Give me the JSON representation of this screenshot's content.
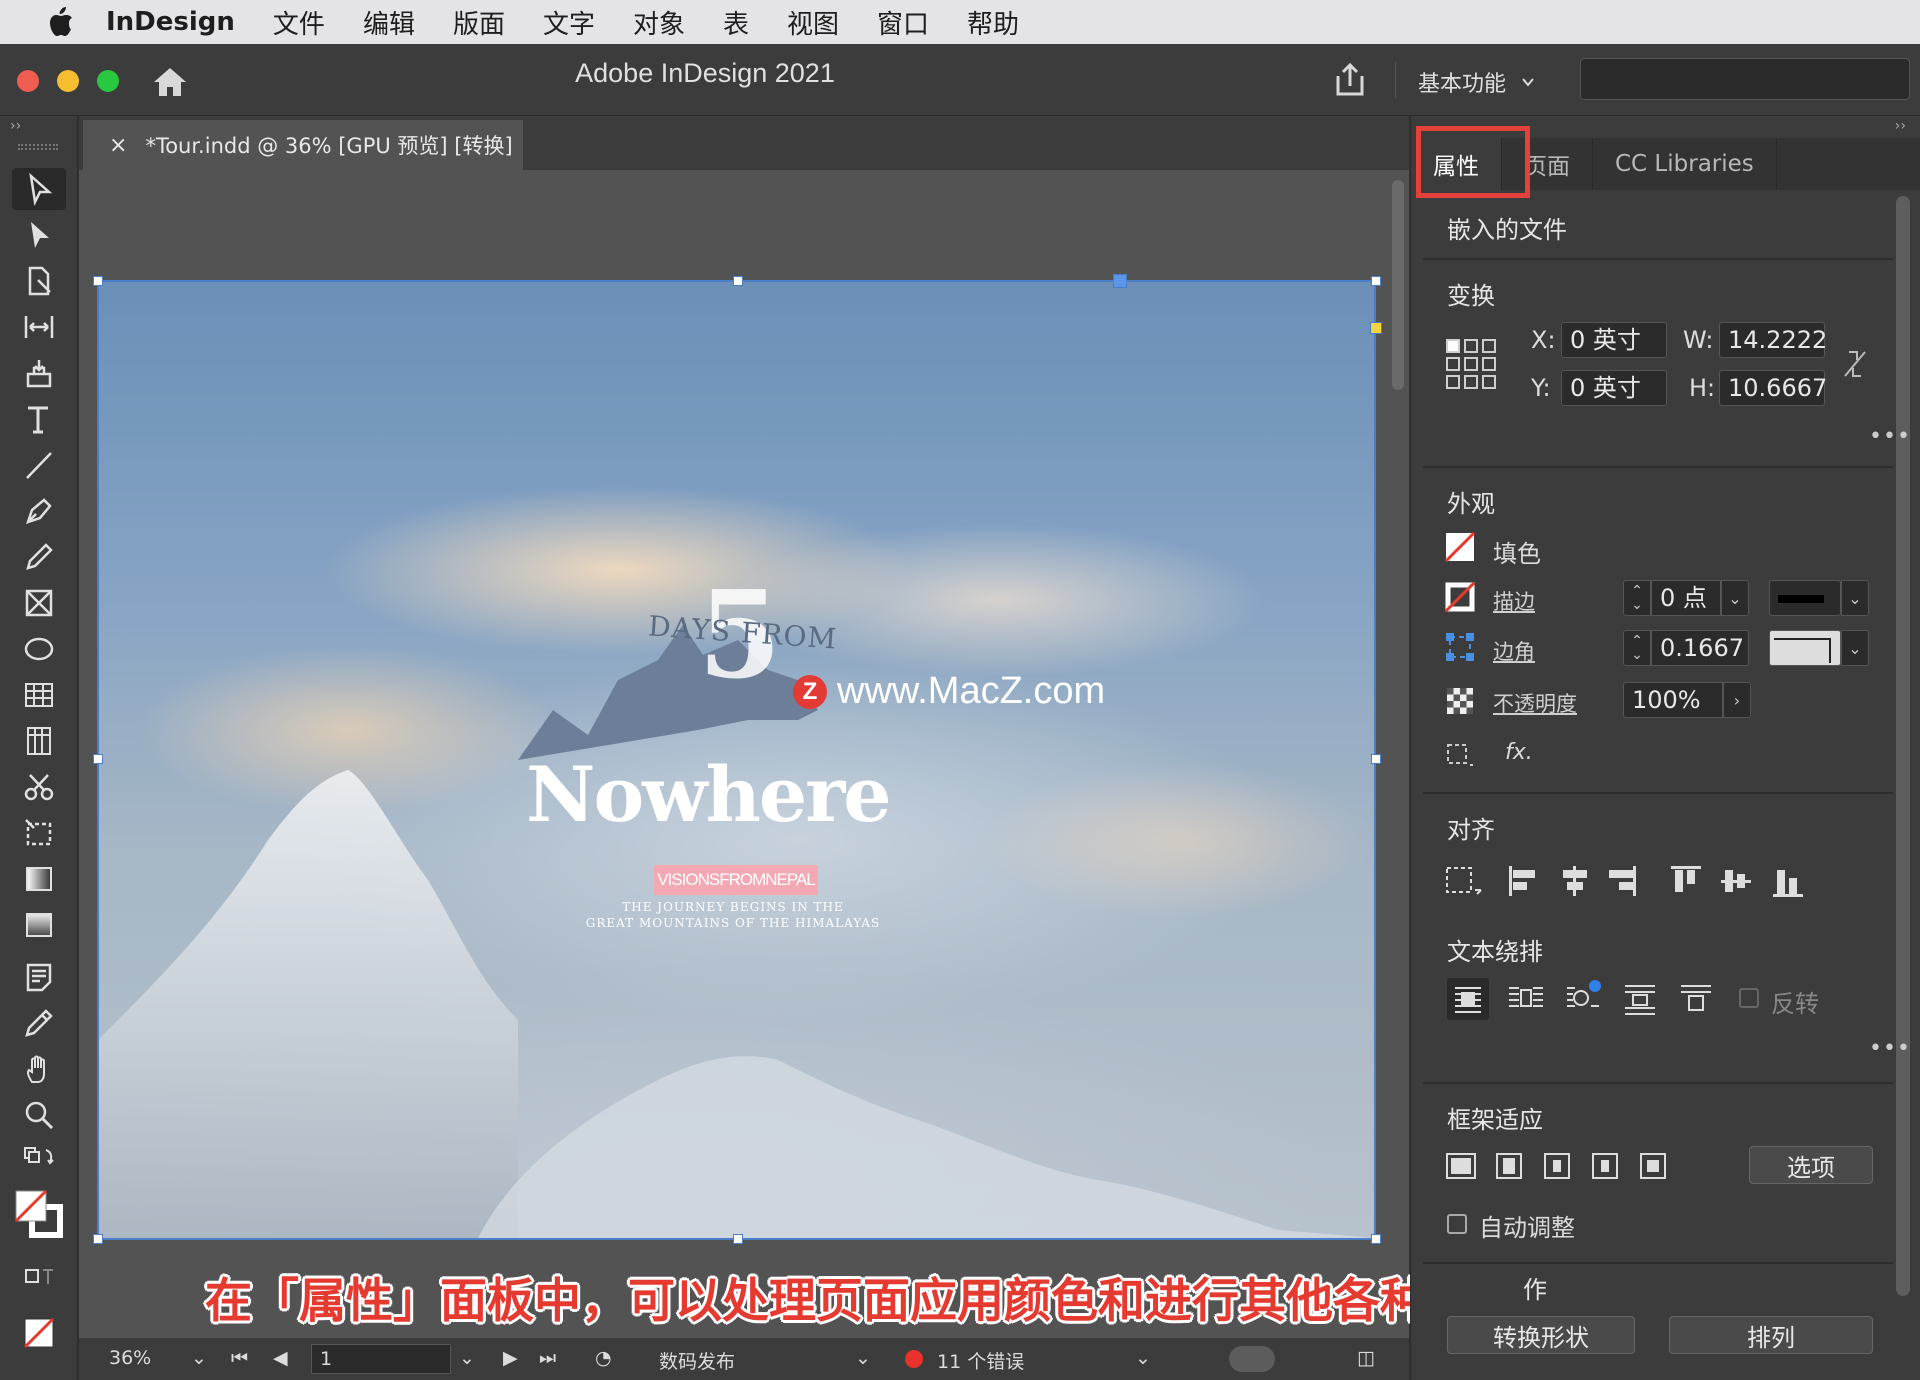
{
  "menubar": {
    "app_name": "InDesign",
    "items": [
      "文件",
      "编辑",
      "版面",
      "文字",
      "对象",
      "表",
      "视图",
      "窗口",
      "帮助"
    ]
  },
  "titlebar": {
    "title": "Adobe InDesign 2021",
    "workspace": "基本功能"
  },
  "document": {
    "tab_label": "*Tour.indd @ 36% [GPU 预览] [转换]",
    "close_glyph": "×",
    "poster": {
      "big_number": "5",
      "days_from": "DAYS FROM",
      "nowhere": "Nowhere",
      "vision": "VISIONSFROMNEPAL",
      "line1": "THE JOURNEY BEGINS IN THE",
      "line2": "GREAT MOUNTAINS OF THE HIMALAYAS"
    },
    "watermark": "www.MacZ.com",
    "watermark_logo": "Z",
    "caption": "在「属性」面板中，可以处理页面应用颜色和进行其他各种操作"
  },
  "statusbar": {
    "zoom": "36%",
    "page": "1",
    "publish": "数码发布",
    "errors": "11 个错误"
  },
  "panel": {
    "tabs": [
      "属性",
      "页面",
      "CC Libraries"
    ],
    "active_tab": "属性",
    "embedded_title": "嵌入的文件",
    "transform": {
      "title": "变换",
      "x_label": "X:",
      "x_value": "0 英寸",
      "y_label": "Y:",
      "y_value": "0 英寸",
      "w_label": "W:",
      "w_value": "14.2222",
      "h_label": "H:",
      "h_value": "10.6667"
    },
    "appearance": {
      "title": "外观",
      "fill_label": "填色",
      "stroke_label": "描边",
      "stroke_weight": "0 点",
      "corner_label": "边角",
      "corner_value": "0.1667",
      "opacity_label": "不透明度",
      "opacity_value": "100%",
      "fx_label": "fx."
    },
    "align": {
      "title": "对齐"
    },
    "text_wrap": {
      "title": "文本绕排",
      "invert_label": "反转"
    },
    "frame_fitting": {
      "title": "框架适应",
      "options_button": "选项",
      "auto_fit_label": "自动调整"
    },
    "quick_actions": {
      "title_partial": "作",
      "convert_shape_button": "转换形状",
      "arrange_button": "排列"
    },
    "more_glyph": "•••"
  },
  "colors": {
    "accent_highlight": "#e3413a",
    "selection": "#4a7ec8",
    "error_dot": "#e8322b",
    "caption_red": "#e53a2f",
    "vision_pink": "#f3a9b4"
  }
}
